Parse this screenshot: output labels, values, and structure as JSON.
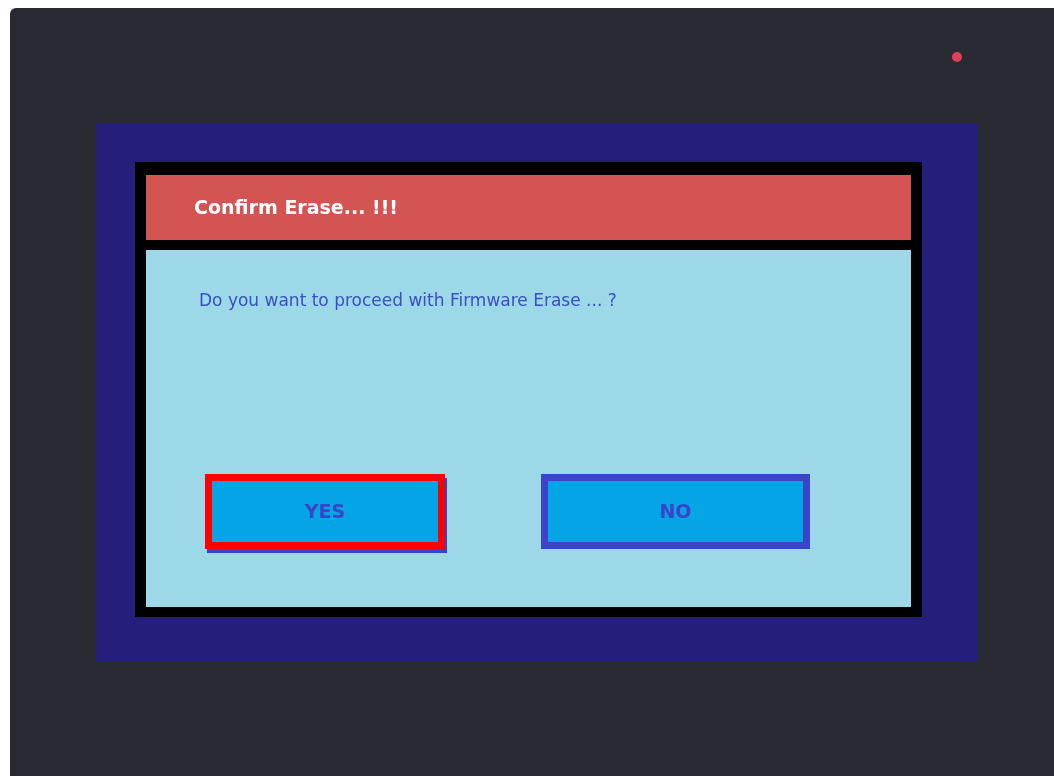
{
  "dialog": {
    "title": "Confirm Erase... !!!",
    "message": "Do you want to proceed with Firmware Erase ... ?",
    "buttons": [
      {
        "label": "YES",
        "selected": true
      },
      {
        "label": "NO",
        "selected": false
      }
    ]
  }
}
